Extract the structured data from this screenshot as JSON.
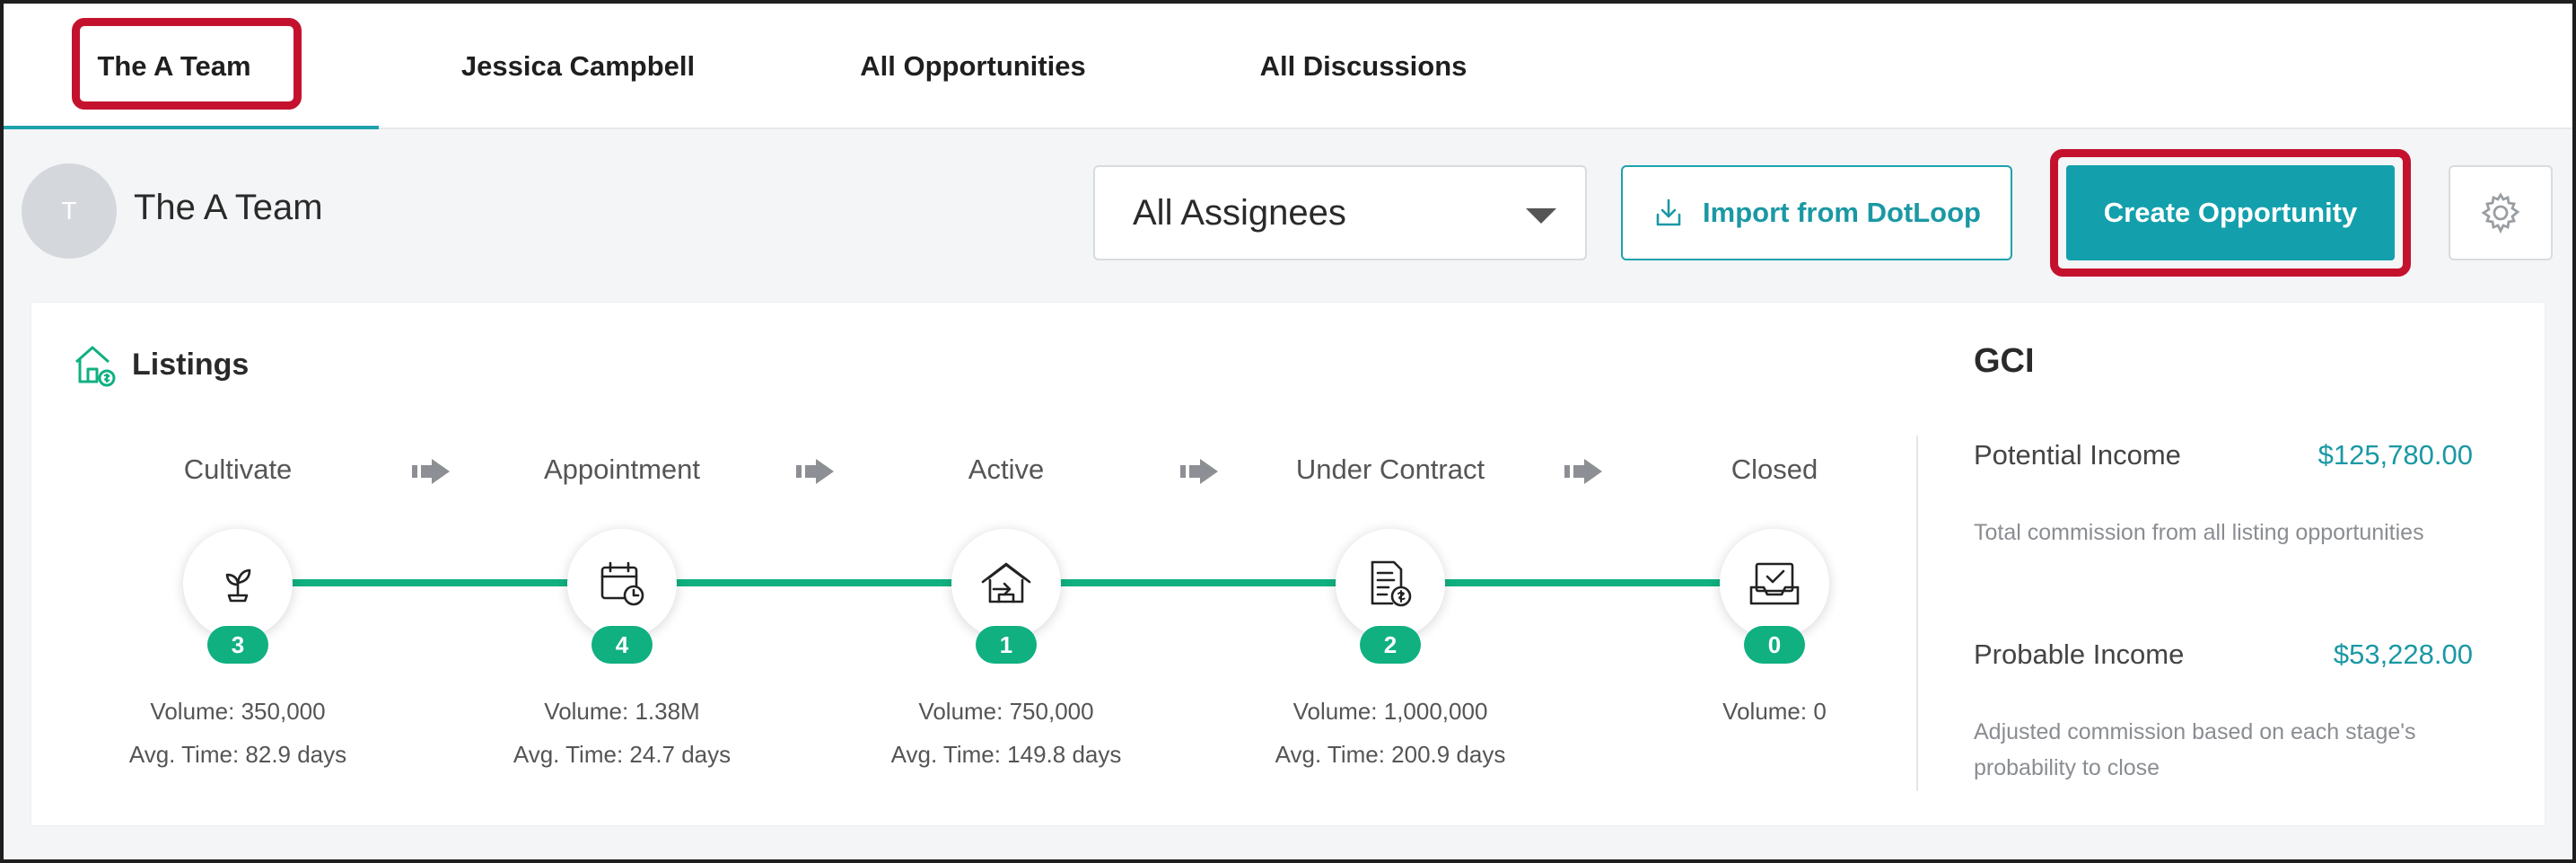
{
  "tabs": [
    {
      "label": "The A Team"
    },
    {
      "label": "Jessica Campbell"
    },
    {
      "label": "All Opportunities"
    },
    {
      "label": "All Discussions"
    }
  ],
  "team": {
    "avatar_initial": "T",
    "name": "The A Team"
  },
  "assignee_select": {
    "value": "All Assignees"
  },
  "buttons": {
    "import_label": "Import from DotLoop",
    "create_label": "Create Opportunity"
  },
  "listings": {
    "title": "Listings",
    "stages": [
      {
        "name": "Cultivate",
        "count": "3",
        "volume": "Volume: 350,000",
        "avg_time": "Avg. Time: 82.9 days",
        "icon": "plant-icon"
      },
      {
        "name": "Appointment",
        "count": "4",
        "volume": "Volume: 1.38M",
        "avg_time": "Avg. Time: 24.7 days",
        "icon": "calendar-clock-icon"
      },
      {
        "name": "Active",
        "count": "1",
        "volume": "Volume: 750,000",
        "avg_time": "Avg. Time: 149.8 days",
        "icon": "house-arrow-icon"
      },
      {
        "name": "Under Contract",
        "count": "2",
        "volume": "Volume: 1,000,000",
        "avg_time": "Avg. Time: 200.9 days",
        "icon": "contract-dollar-icon"
      },
      {
        "name": "Closed",
        "count": "0",
        "volume": "Volume: 0",
        "avg_time": "",
        "icon": "inbox-check-icon"
      }
    ]
  },
  "gci": {
    "title": "GCI",
    "potential": {
      "label": "Potential Income",
      "value": "$125,780.00",
      "description": "Total commission from all listing opportunities"
    },
    "probable": {
      "label": "Probable Income",
      "value": "$53,228.00",
      "description": "Adjusted commission based on each stage's probability to close"
    }
  },
  "colors": {
    "accent": "#13a0ac",
    "pipeline_green": "#10b081",
    "highlight_red": "#c4122e"
  }
}
